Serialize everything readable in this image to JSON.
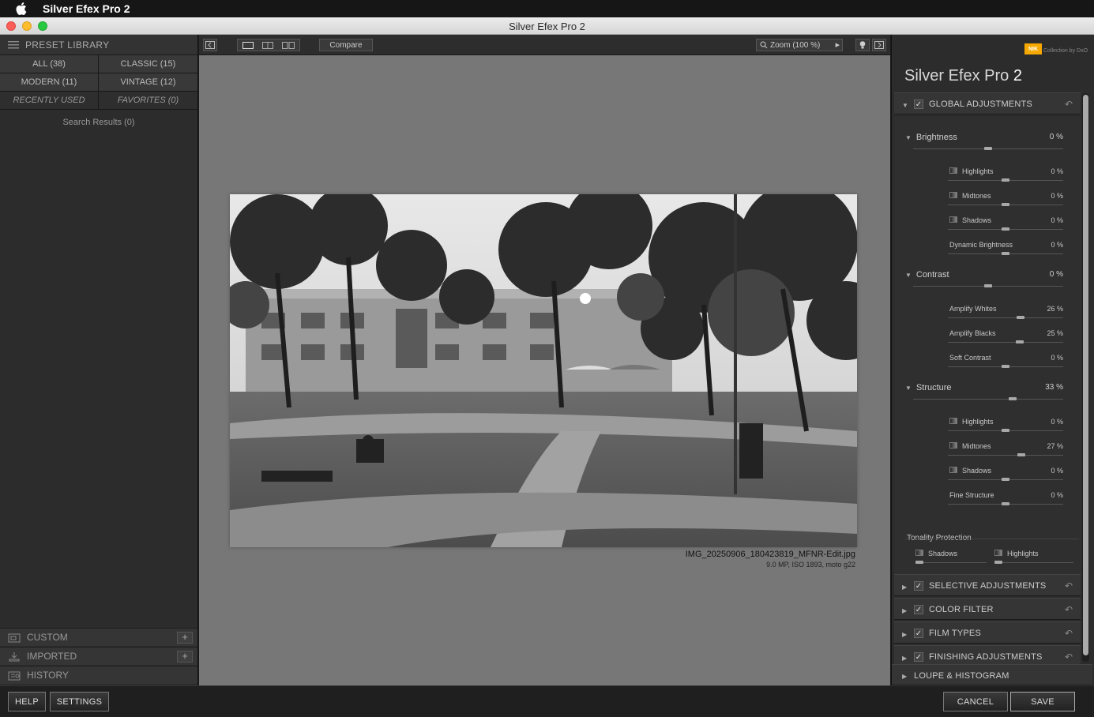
{
  "menubar": {
    "app_name": "Silver Efex Pro 2"
  },
  "window": {
    "title": "Silver Efex Pro 2"
  },
  "library": {
    "header": "PRESET LIBRARY",
    "filters": [
      "ALL (38)",
      "CLASSIC (15)",
      "MODERN (11)",
      "VINTAGE (12)",
      "RECENTLY USED",
      "FAVORITES (0)"
    ],
    "search_results": "Search Results (0)",
    "bottom": {
      "custom": "CUSTOM",
      "imported": "IMPORTED",
      "history": "HISTORY"
    }
  },
  "toolbar": {
    "compare": "Compare",
    "zoom": "Zoom (100 %)"
  },
  "image": {
    "filename": "IMG_20250906_180423819_MFNR-Edit.jpg",
    "info": "9.0 MP, ISO 1893, moto g22"
  },
  "right": {
    "brand_logo": "NIK",
    "brand_sub": "Collection by DxO",
    "app_title": "Silver Efex Pro",
    "app_version": "2",
    "global": {
      "label": "GLOBAL ADJUSTMENTS",
      "brightness": {
        "label": "Brightness",
        "value": "0 %",
        "level": 0,
        "subs": [
          {
            "label": "Highlights",
            "value": "0 %",
            "level": 0
          },
          {
            "label": "Midtones",
            "value": "0 %",
            "level": 0
          },
          {
            "label": "Shadows",
            "value": "0 %",
            "level": 0
          },
          {
            "label": "Dynamic Brightness",
            "value": "0 %",
            "level": 0
          }
        ]
      },
      "contrast": {
        "label": "Contrast",
        "value": "0 %",
        "level": 0,
        "subs": [
          {
            "label": "Amplify Whites",
            "value": "26 %",
            "level": 26
          },
          {
            "label": "Amplify Blacks",
            "value": "25 %",
            "level": 25
          },
          {
            "label": "Soft Contrast",
            "value": "0 %",
            "level": 0
          }
        ]
      },
      "structure": {
        "label": "Structure",
        "value": "33 %",
        "level": 33,
        "subs": [
          {
            "label": "Highlights",
            "value": "0 %",
            "level": 0
          },
          {
            "label": "Midtones",
            "value": "27 %",
            "level": 27
          },
          {
            "label": "Shadows",
            "value": "0 %",
            "level": 0
          },
          {
            "label": "Fine Structure",
            "value": "0 %",
            "level": 0
          }
        ]
      },
      "tonality": {
        "label": "Tonality Protection",
        "shadows": "Shadows",
        "highlights": "Highlights"
      }
    },
    "sections": [
      "SELECTIVE ADJUSTMENTS",
      "COLOR FILTER",
      "FILM TYPES",
      "FINISHING ADJUSTMENTS"
    ],
    "loupe": "LOUPE & HISTOGRAM"
  },
  "buttons": {
    "help": "HELP",
    "settings": "SETTINGS",
    "cancel": "CANCEL",
    "save": "SAVE"
  }
}
